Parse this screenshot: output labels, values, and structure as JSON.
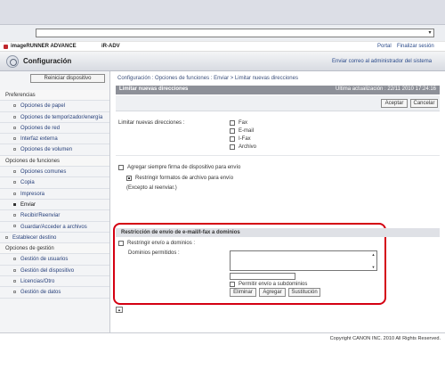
{
  "browser": {
    "address_value": "",
    "dropdown_icon": "▾"
  },
  "header": {
    "brand_name": "imageRUNNER ADVANCE",
    "model": "iR-ADV",
    "portal_link": "Portal",
    "logout_link": "Finalizar sesión",
    "page_title": "Configuración",
    "admin_mail_link": "Enviar correo al administrador del sistema"
  },
  "sidebar": {
    "restart_label": "Reiniciar dispositivo",
    "items": [
      {
        "label": "Preferencias",
        "type": "group"
      },
      {
        "label": "Opciones de papel",
        "type": "sub"
      },
      {
        "label": "Opciones de temporizador/energía",
        "type": "sub"
      },
      {
        "label": "Opciones de red",
        "type": "sub"
      },
      {
        "label": "Interfaz externa",
        "type": "sub"
      },
      {
        "label": "Opciones de volumen",
        "type": "sub"
      },
      {
        "label": "Opciones de funciones",
        "type": "group"
      },
      {
        "label": "Opciones comunes",
        "type": "sub"
      },
      {
        "label": "Copia",
        "type": "sub"
      },
      {
        "label": "Impresora",
        "type": "sub"
      },
      {
        "label": "Enviar",
        "type": "sub",
        "active": true
      },
      {
        "label": "Recibir/Reenviar",
        "type": "sub"
      },
      {
        "label": "Guardar/Acceder a archivos",
        "type": "sub"
      },
      {
        "label": "Establecer destino",
        "type": "plain"
      },
      {
        "label": "Opciones de gestión",
        "type": "group"
      },
      {
        "label": "Gestión de usuarios",
        "type": "sub"
      },
      {
        "label": "Gestión del dispositivo",
        "type": "sub"
      },
      {
        "label": "Licencias/Otro",
        "type": "sub"
      },
      {
        "label": "Gestión de datos",
        "type": "sub"
      }
    ]
  },
  "main": {
    "breadcrumb": "Configuración : Opciones de funciones : Enviar > Limitar nuevas direcciones",
    "panel_title": "Limitar nuevas direcciones",
    "last_updated": "Última actualización : 22/11 2010 17:24:16",
    "accept_label": "Aceptar",
    "cancel_label": "Cancelar",
    "limit_label": "Limitar nuevas direcciones :",
    "limit_options": [
      "Fax",
      "E-mail",
      "I-Fax",
      "Archivo"
    ],
    "add_signature_label": "Agregar siempre firma de dispositivo para envío",
    "restrict_formats_label": "Restringir formatos de archivo para envío",
    "except_resend_label": "(Excepto al reenviar.)",
    "section_title": "Restricción de envío de e-mail/I-fax a dominios",
    "restrict_domain_label": "Restringir envío a dominios :",
    "allowed_domains_label": "Dominios permitidos :",
    "subdomain_label": "Permitir envío a subdominios",
    "delete_label": "Eliminar",
    "add_label": "Agregar",
    "replace_label": "Sustitución",
    "copyright": "Copyright CANON INC. 2010 All Rights Reserved."
  },
  "icons": {
    "scroll_up": "▲",
    "scroll_down": "▼",
    "toggle": "▲"
  },
  "colors": {
    "highlight": "#d40012",
    "panel_header": "#8d9098",
    "link": "#2a4a8a"
  }
}
